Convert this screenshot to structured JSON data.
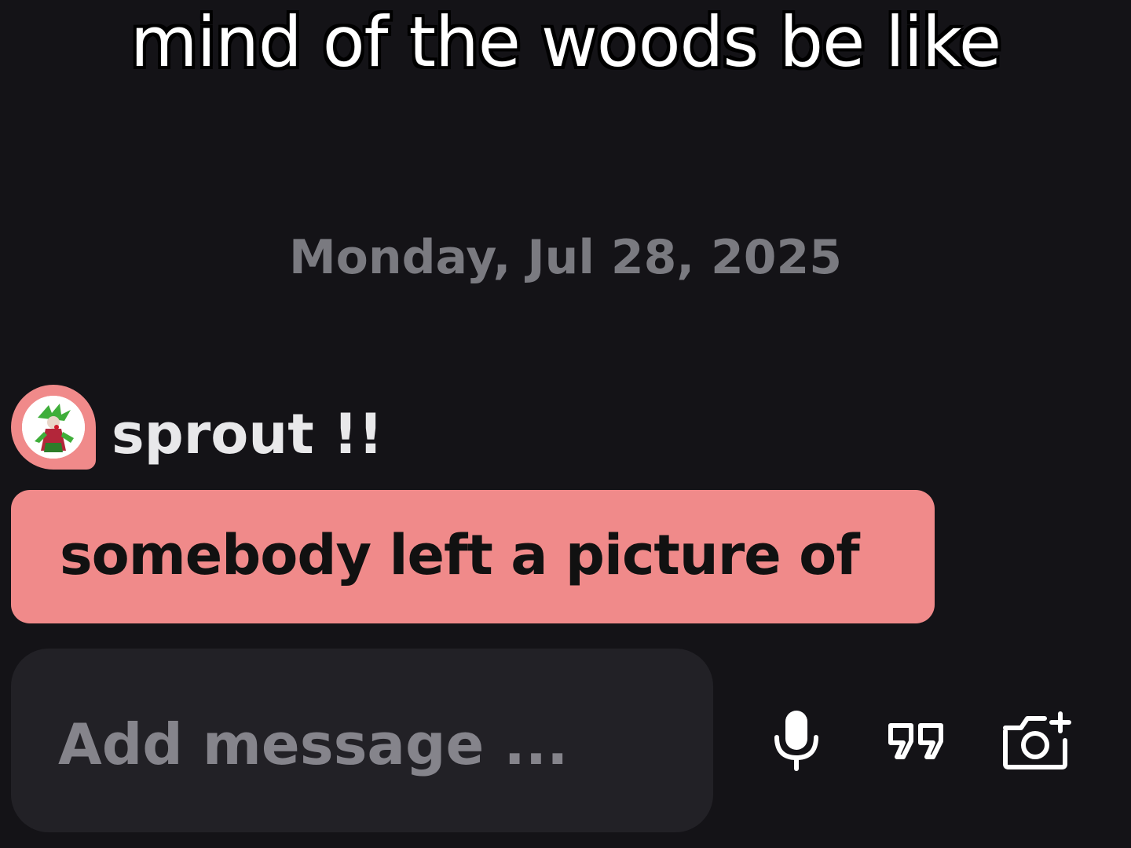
{
  "caption": "mind of the woods be like",
  "chat": {
    "date_divider": "Monday, Jul 28, 2025",
    "sender": {
      "name": "sprout !!",
      "avatar_color": "#f08a8a"
    },
    "message": {
      "text": "somebody left a picture of",
      "bubble_color": "#f08a8a"
    }
  },
  "composer": {
    "placeholder": "Add message ...",
    "value": "",
    "icons": [
      "microphone-icon",
      "quote-icon",
      "camera-add-icon"
    ]
  },
  "colors": {
    "background": "#141317",
    "composer": "#222126",
    "muted_text": "#7a7a80"
  }
}
